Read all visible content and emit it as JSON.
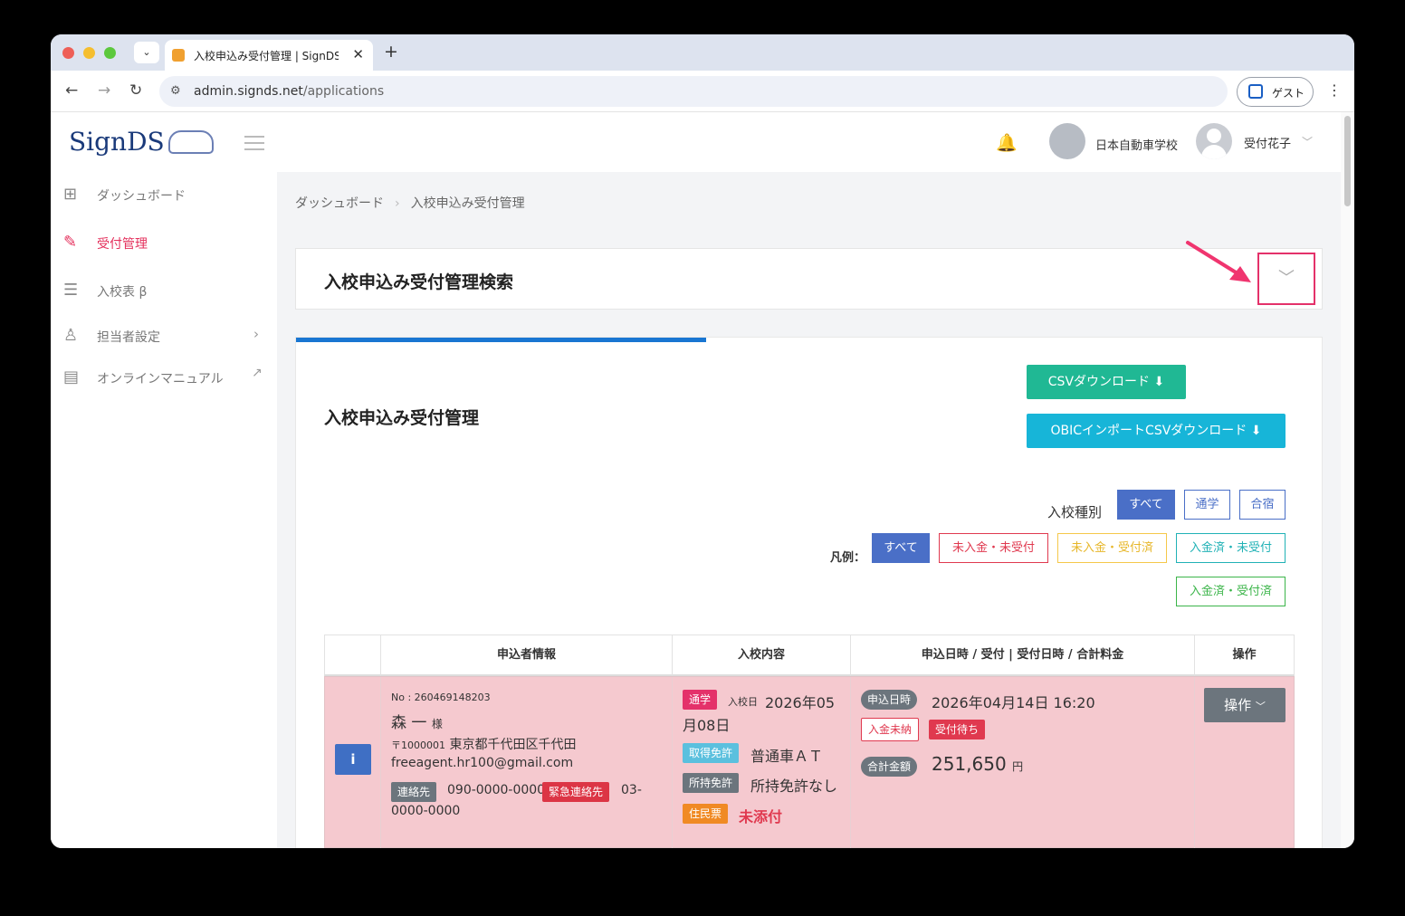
{
  "browser": {
    "tab_title": "入校申込み受付管理 | SignDS（",
    "url_host": "admin.signds.net",
    "url_path": "/applications",
    "profile_label": "ゲスト"
  },
  "header": {
    "logo": "SignDS",
    "school_name": "日本自動車学校",
    "user_name": "受付花子"
  },
  "sidebar": {
    "items": [
      {
        "label": "ダッシュボード",
        "icon": "dashboard-icon"
      },
      {
        "label": "受付管理",
        "icon": "reception-icon",
        "active": true
      },
      {
        "label": "入校表 β",
        "icon": "list-icon"
      },
      {
        "label": "担当者設定",
        "icon": "user-icon"
      },
      {
        "label": "オンラインマニュアル",
        "icon": "book-icon"
      }
    ]
  },
  "breadcrumb": {
    "home": "ダッシュボード",
    "current": "入校申込み受付管理"
  },
  "search_panel": {
    "title": "入校申込み受付管理検索"
  },
  "main": {
    "title": "入校申込み受付管理",
    "csv_button": "CSVダウンロード",
    "obic_button": "OBICインポートCSVダウンロード",
    "type_filter": {
      "label": "入校種別",
      "options": [
        "すべて",
        "通学",
        "合宿"
      ]
    },
    "legend": {
      "label": "凡例：",
      "options": [
        "すべて",
        "未入金・未受付",
        "未入金・受付済",
        "入金済・未受付",
        "入金済・受付済"
      ]
    },
    "table": {
      "columns": [
        "申込者情報",
        "入校内容",
        "申込日時 / 受付 | 受付日時 / 合計料金",
        "操作"
      ],
      "rows": [
        {
          "no": "No : 260469148203",
          "name": "森 一",
          "honorific": "様",
          "postal": "〒1000001",
          "address": "東京都千代田区千代田",
          "email": "freeagent.hr100@gmail.com",
          "contact_label": "連絡先",
          "contact": "090-0000-0000",
          "emergency_label": "緊急連絡先",
          "emergency_1": "03-",
          "emergency_2": "0000-0000",
          "course_type": "通学",
          "entry_label": "入校日",
          "entry_date_1": "2026年05",
          "entry_date_2": "月08日",
          "license_label": "取得免許",
          "license": "普通車ＡＴ",
          "owned_label": "所持免許",
          "owned": "所持免許なし",
          "resident_label": "住民票",
          "resident": "未添付",
          "applied_label": "申込日時",
          "applied_at": "2026年04月14日 16:20",
          "payment_status": "入金未納",
          "reception_status": "受付待ち",
          "total_label": "合計金額",
          "total": "251,650",
          "currency": "円",
          "action": "操作"
        }
      ]
    }
  },
  "colors": {
    "accent_red": "#e4315d",
    "teal": "#20b894",
    "cyan": "#17b5d8",
    "blue": "#4a6fc7",
    "row_pink": "#f5c9cf"
  }
}
